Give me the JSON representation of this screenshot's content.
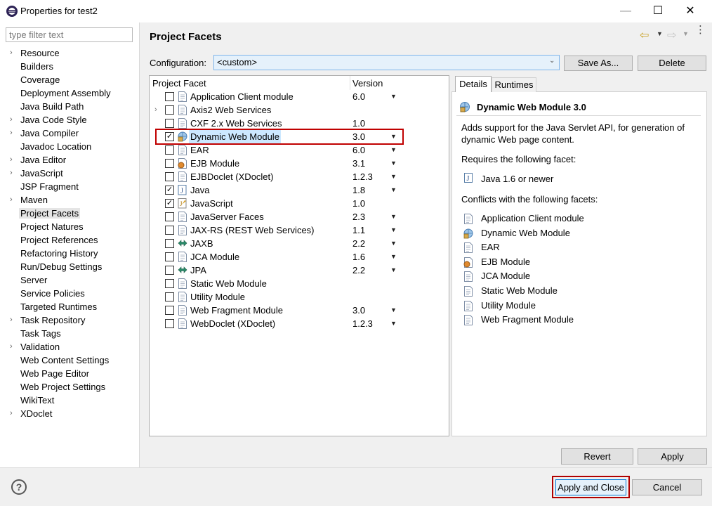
{
  "window": {
    "title": "Properties for test2",
    "min_glyph": "—",
    "max_glyph": "☐",
    "close_glyph": "✕"
  },
  "filter": {
    "placeholder": "type filter text"
  },
  "nav": {
    "items": [
      {
        "label": "Resource",
        "expandable": true
      },
      {
        "label": "Builders",
        "expandable": false
      },
      {
        "label": "Coverage",
        "expandable": false
      },
      {
        "label": "Deployment Assembly",
        "expandable": false
      },
      {
        "label": "Java Build Path",
        "expandable": false
      },
      {
        "label": "Java Code Style",
        "expandable": true
      },
      {
        "label": "Java Compiler",
        "expandable": true
      },
      {
        "label": "Javadoc Location",
        "expandable": false
      },
      {
        "label": "Java Editor",
        "expandable": true
      },
      {
        "label": "JavaScript",
        "expandable": true
      },
      {
        "label": "JSP Fragment",
        "expandable": false
      },
      {
        "label": "Maven",
        "expandable": true
      },
      {
        "label": "Project Facets",
        "expandable": false,
        "selected": true
      },
      {
        "label": "Project Natures",
        "expandable": false
      },
      {
        "label": "Project References",
        "expandable": false
      },
      {
        "label": "Refactoring History",
        "expandable": false
      },
      {
        "label": "Run/Debug Settings",
        "expandable": false
      },
      {
        "label": "Server",
        "expandable": false
      },
      {
        "label": "Service Policies",
        "expandable": false
      },
      {
        "label": "Targeted Runtimes",
        "expandable": false
      },
      {
        "label": "Task Repository",
        "expandable": true
      },
      {
        "label": "Task Tags",
        "expandable": false
      },
      {
        "label": "Validation",
        "expandable": true
      },
      {
        "label": "Web Content Settings",
        "expandable": false
      },
      {
        "label": "Web Page Editor",
        "expandable": false
      },
      {
        "label": "Web Project Settings",
        "expandable": false
      },
      {
        "label": "WikiText",
        "expandable": false
      },
      {
        "label": "XDoclet",
        "expandable": true
      }
    ]
  },
  "header": {
    "title": "Project Facets",
    "back_glyph": "⇦",
    "forward_glyph": "⇨",
    "dropdown_glyph": "▼",
    "menu_glyph": "⋮"
  },
  "config": {
    "label": "Configuration:",
    "value": "<custom>",
    "save_as_label": "Save As...",
    "delete_label": "Delete"
  },
  "facets": {
    "col_facet": "Project Facet",
    "col_version": "Version",
    "rows": [
      {
        "name": "Application Client module",
        "version": "6.0",
        "dropdown": true,
        "checked": false,
        "icon": "page-icon"
      },
      {
        "name": "Axis2 Web Services",
        "version": "",
        "dropdown": false,
        "checked": false,
        "icon": "page-icon",
        "expandable": true
      },
      {
        "name": "CXF 2.x Web Services",
        "version": "1.0",
        "dropdown": false,
        "checked": false,
        "icon": "page-icon"
      },
      {
        "name": "Dynamic Web Module",
        "version": "3.0",
        "dropdown": true,
        "checked": true,
        "icon": "globe-icon",
        "highlight": true
      },
      {
        "name": "EAR",
        "version": "6.0",
        "dropdown": true,
        "checked": false,
        "icon": "page-icon"
      },
      {
        "name": "EJB Module",
        "version": "3.1",
        "dropdown": true,
        "checked": false,
        "icon": "bean-icon"
      },
      {
        "name": "EJBDoclet (XDoclet)",
        "version": "1.2.3",
        "dropdown": true,
        "checked": false,
        "icon": "page-icon"
      },
      {
        "name": "Java",
        "version": "1.8",
        "dropdown": true,
        "checked": true,
        "icon": "java-icon"
      },
      {
        "name": "JavaScript",
        "version": "1.0",
        "dropdown": false,
        "checked": true,
        "icon": "javascript-icon"
      },
      {
        "name": "JavaServer Faces",
        "version": "2.3",
        "dropdown": true,
        "checked": false,
        "icon": "page-icon"
      },
      {
        "name": "JAX-RS (REST Web Services)",
        "version": "1.1",
        "dropdown": true,
        "checked": false,
        "icon": "page-icon"
      },
      {
        "name": "JAXB",
        "version": "2.2",
        "dropdown": true,
        "checked": false,
        "icon": "arrows-icon"
      },
      {
        "name": "JCA Module",
        "version": "1.6",
        "dropdown": true,
        "checked": false,
        "icon": "page-icon"
      },
      {
        "name": "JPA",
        "version": "2.2",
        "dropdown": true,
        "checked": false,
        "icon": "arrows-icon"
      },
      {
        "name": "Static Web Module",
        "version": "",
        "dropdown": false,
        "checked": false,
        "icon": "page-icon"
      },
      {
        "name": "Utility Module",
        "version": "",
        "dropdown": false,
        "checked": false,
        "icon": "page-icon"
      },
      {
        "name": "Web Fragment Module",
        "version": "3.0",
        "dropdown": true,
        "checked": false,
        "icon": "page-icon"
      },
      {
        "name": "WebDoclet (XDoclet)",
        "version": "1.2.3",
        "dropdown": true,
        "checked": false,
        "icon": "page-icon"
      }
    ]
  },
  "details": {
    "tab_details": "Details",
    "tab_runtimes": "Runtimes",
    "title": "Dynamic Web Module 3.0",
    "description": "Adds support for the Java Servlet API, for generation of dynamic Web page content.",
    "requires_label": "Requires the following facet:",
    "requires_item": "Java 1.6 or newer",
    "conflicts_label": "Conflicts with the following facets:",
    "conflicts": [
      {
        "name": "Application Client module",
        "icon": "page-icon"
      },
      {
        "name": "Dynamic Web Module",
        "icon": "globe-icon"
      },
      {
        "name": "EAR",
        "icon": "page-icon"
      },
      {
        "name": "EJB Module",
        "icon": "bean-icon"
      },
      {
        "name": "JCA Module",
        "icon": "page-icon"
      },
      {
        "name": "Static Web Module",
        "icon": "page-icon"
      },
      {
        "name": "Utility Module",
        "icon": "page-icon"
      },
      {
        "name": "Web Fragment Module",
        "icon": "page-icon"
      }
    ]
  },
  "footer": {
    "revert_label": "Revert",
    "apply_label": "Apply",
    "help_glyph": "?",
    "apply_close_label": "Apply and Close",
    "cancel_label": "Cancel"
  }
}
